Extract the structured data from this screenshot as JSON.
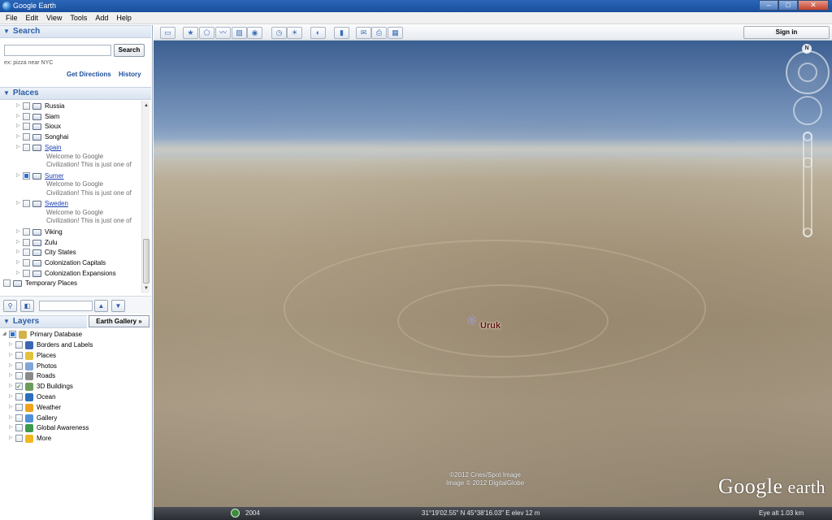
{
  "window": {
    "title": "Google Earth",
    "controls": [
      "–",
      "□",
      "✕"
    ]
  },
  "menu": [
    "File",
    "Edit",
    "View",
    "Tools",
    "Add",
    "Help"
  ],
  "search": {
    "header": "Search",
    "input_value": "",
    "button": "Search",
    "hint": "ex: pizza near NYC",
    "get_directions": "Get Directions",
    "history": "History"
  },
  "places": {
    "header": "Places",
    "items": [
      {
        "label": "Russia",
        "indent": 1,
        "link": false,
        "checked": "none"
      },
      {
        "label": "Siam",
        "indent": 1,
        "link": false,
        "checked": "none"
      },
      {
        "label": "Sioux",
        "indent": 1,
        "link": false,
        "checked": "none"
      },
      {
        "label": "Songhai",
        "indent": 1,
        "link": false,
        "checked": "none"
      },
      {
        "label": "Spain",
        "indent": 1,
        "link": true,
        "checked": "none",
        "desc": [
          "Welcome to Google",
          "Civilization! This is just one of"
        ]
      },
      {
        "label": "Sumer",
        "indent": 1,
        "link": true,
        "checked": "partial",
        "desc": [
          "Welcome to Google",
          "Civilization! This is just one of"
        ]
      },
      {
        "label": "Sweden",
        "indent": 1,
        "link": true,
        "checked": "none",
        "desc": [
          "Welcome to Google",
          "Civilization! This is just one of"
        ]
      },
      {
        "label": "Viking",
        "indent": 1,
        "link": false,
        "checked": "none"
      },
      {
        "label": "Zulu",
        "indent": 1,
        "link": false,
        "checked": "none"
      },
      {
        "label": "City States",
        "indent": 1,
        "link": false,
        "checked": "none"
      },
      {
        "label": "Colonization Capitals",
        "indent": 1,
        "link": false,
        "checked": "none"
      },
      {
        "label": "Colonization Expansions",
        "indent": 1,
        "link": false,
        "checked": "none"
      },
      {
        "label": "Temporary Places",
        "indent": 0,
        "link": false,
        "checked": "none"
      }
    ]
  },
  "layers": {
    "header": "Layers",
    "gallery_button": "Earth Gallery »",
    "root": "Primary Database",
    "items": [
      {
        "label": "Borders and Labels",
        "checked": false,
        "icon": "borders-icon",
        "color": "#3b66b5"
      },
      {
        "label": "Places",
        "checked": false,
        "icon": "places-icon",
        "color": "#e2c23a"
      },
      {
        "label": "Photos",
        "checked": false,
        "icon": "photos-icon",
        "color": "#7fa6d8"
      },
      {
        "label": "Roads",
        "checked": false,
        "icon": "roads-icon",
        "color": "#8a8a8a"
      },
      {
        "label": "3D Buildings",
        "checked": true,
        "icon": "buildings-icon",
        "color": "#6c9c5c"
      },
      {
        "label": "Ocean",
        "checked": false,
        "icon": "ocean-icon",
        "color": "#2c6dbd"
      },
      {
        "label": "Weather",
        "checked": false,
        "icon": "weather-icon",
        "color": "#f0a21f"
      },
      {
        "label": "Gallery",
        "checked": false,
        "icon": "gallery-icon",
        "color": "#4f90d8"
      },
      {
        "label": "Global Awareness",
        "checked": false,
        "icon": "awareness-icon",
        "color": "#3d9a4c"
      },
      {
        "label": "More",
        "checked": false,
        "icon": "more-icon",
        "color": "#f2b620"
      }
    ]
  },
  "toolbar": {
    "buttons": [
      {
        "name": "sidebar-toggle-button",
        "icon": "sidebar-icon",
        "glyph": "▭"
      },
      {
        "name": "add-placemark-button",
        "icon": "placemark-icon",
        "glyph": "★"
      },
      {
        "name": "add-polygon-button",
        "icon": "polygon-icon",
        "glyph": "⬠"
      },
      {
        "name": "add-path-button",
        "icon": "path-icon",
        "glyph": "〰"
      },
      {
        "name": "add-overlay-button",
        "icon": "overlay-icon",
        "glyph": "▨"
      },
      {
        "name": "record-tour-button",
        "icon": "tour-icon",
        "glyph": "◉"
      },
      {
        "name": "historical-imagery-button",
        "icon": "history-icon",
        "glyph": "◷"
      },
      {
        "name": "sunlight-button",
        "icon": "sun-icon",
        "glyph": "☀"
      },
      {
        "name": "switch-planet-button",
        "icon": "planet-icon",
        "glyph": "◐"
      },
      {
        "name": "ruler-button",
        "icon": "ruler-icon",
        "glyph": "▮"
      },
      {
        "name": "email-button",
        "icon": "email-icon",
        "glyph": "✉"
      },
      {
        "name": "print-button",
        "icon": "print-icon",
        "glyph": "⎙"
      },
      {
        "name": "view-in-maps-button",
        "icon": "maps-icon",
        "glyph": "▦"
      }
    ],
    "signin": "Sign in"
  },
  "map": {
    "placemark_label": "Uruk",
    "copyright_lines": [
      "©2012 Cnes/Spot Image",
      "Image © 2012 DigitalGlobe"
    ],
    "logo_google": "Google",
    "logo_earth": " earth",
    "compass_letter": "N"
  },
  "status": {
    "imagery_year": "2004",
    "coords": "31°19'02.55\" N  45°38'16.03\" E  elev    12 m",
    "eye_alt": "Eye alt    1.03 km"
  }
}
